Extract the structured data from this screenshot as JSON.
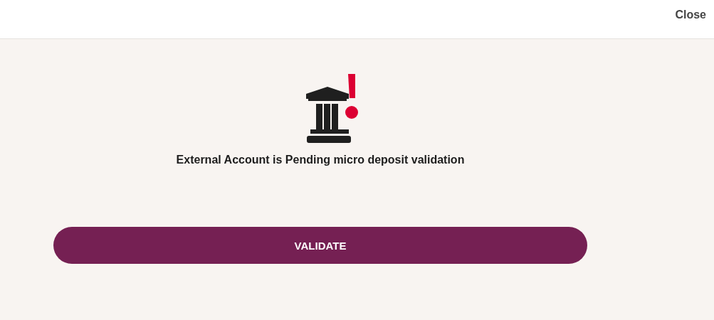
{
  "header": {
    "close_label": "Close"
  },
  "message": "External Account is Pending micro deposit validation",
  "buttons": [
    "VALIDATE"
  ]
}
